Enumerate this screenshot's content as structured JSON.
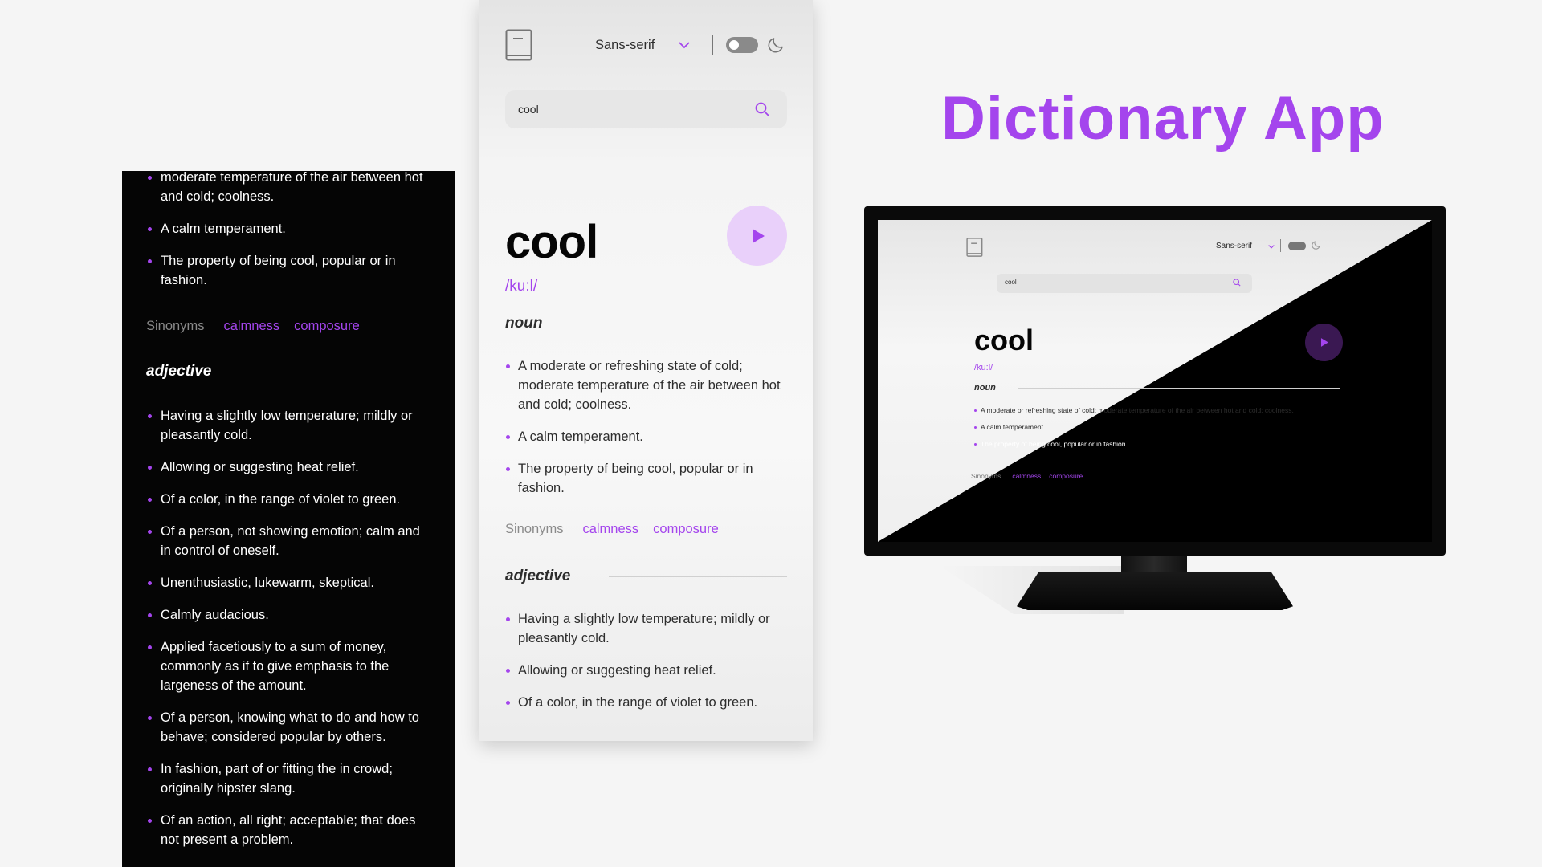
{
  "title": "Dictionary App",
  "colors": {
    "accent": "#a445ed",
    "dark_bg": "#050505",
    "light_bg": "#f4f4f4"
  },
  "header": {
    "font_label": "Sans-serif",
    "icons": [
      "book-icon",
      "chevron-down-icon",
      "theme-toggle",
      "moon-icon"
    ]
  },
  "search": {
    "value": "cool"
  },
  "entry": {
    "word": "cool",
    "phonetic": "/ku:l/",
    "noun": {
      "label": "noun",
      "definitions": [
        "A moderate or refreshing state of cold; moderate temperature of the air between hot and cold; coolness.",
        "A calm temperament.",
        "The property of being cool, popular or in fashion."
      ],
      "synonyms_label": "Sinonyms",
      "synonyms": [
        "calmness",
        "composure"
      ]
    },
    "adjective": {
      "label": "adjective",
      "definitions": [
        "Having a slightly low temperature; mildly or pleasantly cold.",
        "Allowing or suggesting heat relief.",
        "Of a color, in the range of violet to green.",
        "Of a person, not showing emotion; calm and in control of oneself.",
        "Unenthusiastic, lukewarm, skeptical.",
        "Calmly audacious.",
        "Applied facetiously to a sum of money, commonly as if to give emphasis to the largeness of the amount.",
        "Of a person, knowing what to do and how to behave; considered popular by others.",
        "In fashion, part of or fitting the in crowd; originally hipster slang.",
        "Of an action, all right; acceptable; that does not present a problem."
      ]
    }
  },
  "dark_panel": {
    "fragment": "moderate temperature of the air between hot and cold; coolness."
  },
  "monitor": {
    "font_label": "Sans-serif",
    "search_value": "cool",
    "word": "cool",
    "phonetic": "/ku:l/",
    "pos": "noun",
    "definitions": [
      "A moderate or refreshing state of cold; moderate temperature of the air between hot and cold; coolness.",
      "A calm temperament.",
      "The property of being cool, popular or in fashion."
    ],
    "synonyms_label": "Sinonyms",
    "synonyms": [
      "calmness",
      "composure"
    ]
  }
}
